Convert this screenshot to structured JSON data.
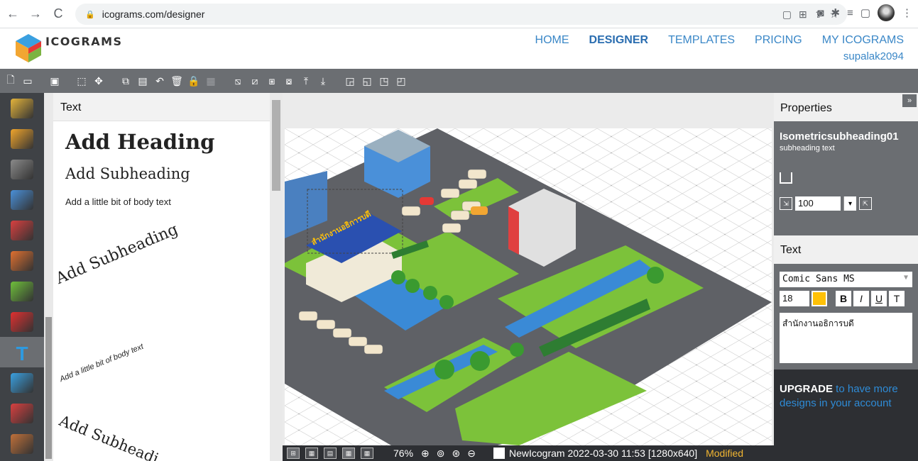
{
  "browser": {
    "url": "icograms.com/designer",
    "back": "←",
    "forward": "→",
    "reload": "C"
  },
  "app": {
    "brand": "ICOGRAMS",
    "nav": [
      {
        "label": "HOME",
        "active": false
      },
      {
        "label": "DESIGNER",
        "active": true
      },
      {
        "label": "TEMPLATES",
        "active": false
      },
      {
        "label": "PRICING",
        "active": false
      },
      {
        "label": "MY ICOGRAMS",
        "active": false
      }
    ],
    "user": "supalak2094"
  },
  "categories": [
    {
      "icon": "vehicles-icon",
      "color": "#e4b43b"
    },
    {
      "icon": "ground-tiles-icon",
      "color": "#f0a52c"
    },
    {
      "icon": "road-icon",
      "color": "#8a8a8a"
    },
    {
      "icon": "buildings-icon",
      "color": "#4a90d9"
    },
    {
      "icon": "transport-icon",
      "color": "#d94040"
    },
    {
      "icon": "people-icon",
      "color": "#e07030"
    },
    {
      "icon": "trees-icon",
      "color": "#6fbf3b"
    },
    {
      "icon": "map-pin-icon",
      "color": "#e03030"
    },
    {
      "icon": "text-icon",
      "color": "#2e9ae0",
      "active": true
    },
    {
      "icon": "chart-icon",
      "color": "#3aa0e0"
    },
    {
      "icon": "shapes-icon",
      "color": "#d94040"
    },
    {
      "icon": "landmarks-icon",
      "color": "#c0703a"
    }
  ],
  "text_panel": {
    "title": "Text",
    "items": {
      "heading": "Add Heading",
      "subheading": "Add Subheading",
      "body": "Add a little bit of body text",
      "curved_subheading": "Add Subheading",
      "curved_body": "Add a little bit of body text",
      "curved_subheading_2": "Add Subheadi"
    }
  },
  "canvas": {
    "label_text": "สำนักงานอธิการบดี"
  },
  "statusbar": {
    "zoom": "76%",
    "doc_title": "NewIcogram 2022-03-30 11:53 [1280x640]",
    "state": "Modified"
  },
  "properties": {
    "title": "Properties",
    "object_name": "Isometricsubheading01",
    "object_tags": "subheading  text",
    "opacity": "100",
    "text_section_title": "Text",
    "font": "Comic Sans MS",
    "font_size": "18",
    "text_color": "#ffc107",
    "bold": "B",
    "italic": "I",
    "underline": "U",
    "strike": "T",
    "text_value": "สำนักงานอธิการบดี"
  },
  "upgrade": {
    "strong": "UPGRADE",
    "rest": " to have more designs in your account"
  }
}
